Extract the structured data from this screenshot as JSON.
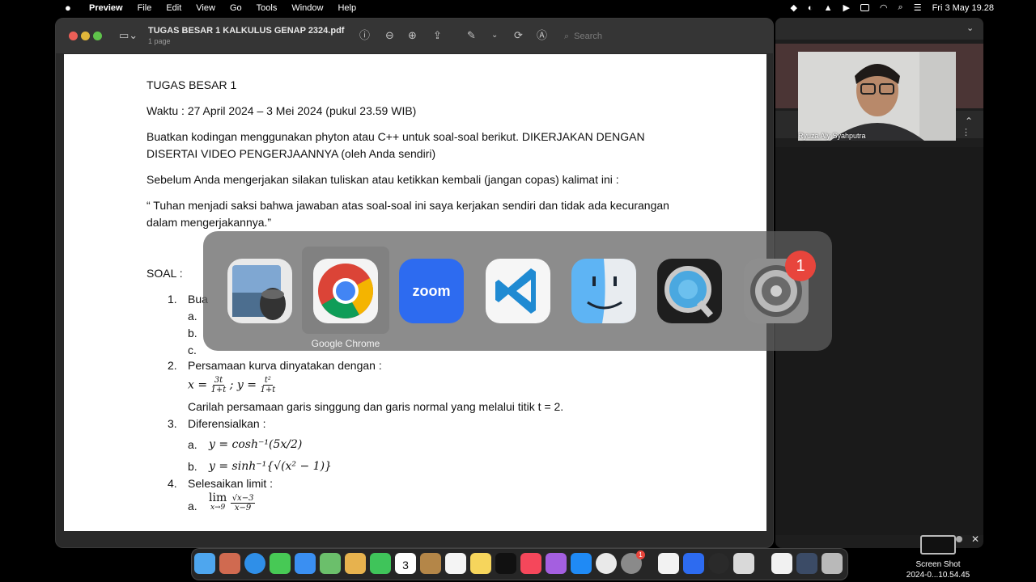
{
  "menubar": {
    "app": "Preview",
    "items": [
      "File",
      "Edit",
      "View",
      "Go",
      "Tools",
      "Window",
      "Help"
    ],
    "clock": "Fri 3 May  19.28"
  },
  "window": {
    "title": "TUGAS BESAR 1 KALKULUS GENAP 2324.pdf",
    "subtitle": "1 page",
    "search_placeholder": "Search"
  },
  "document": {
    "heading": "TUGAS BESAR 1",
    "time": "Waktu : 27 April 2024 – 3 Mei 2024 (pukul 23.59 WIB)",
    "instr1": "Buatkan kodingan menggunakan phyton atau C++ untuk soal-soal berikut. DIKERJAKAN DENGAN",
    "instr2": "DISERTAI VIDEO PENGERJAANNYA (oleh Anda sendiri)",
    "before": "Sebelum Anda mengerjakan silakan tuliskan atau ketikkan kembali (jangan copas) kalimat ini :",
    "quote1": "“ Tuhan menjadi saksi bahwa jawaban atas soal-soal ini saya kerjakan sendiri dan tidak ada kecurangan",
    "quote2": "dalam mengerjakannya.”",
    "soal": "SOAL :",
    "q1_num": "1.",
    "q1_text": "Bua",
    "q1_a": "a.",
    "q1_b": "b.",
    "q1_c": "c.",
    "q2_num": "2.",
    "q2_text": "Persamaan kurva dinyatakan dengan :",
    "q2_x": "x =",
    "q2_x_num": "3t",
    "q2_x_den": "1+t",
    "q2_y": "; y =",
    "q2_y_num": "t²",
    "q2_y_den": "1+t",
    "q2_task": "Carilah persamaan garis singgung dan garis normal yang melalui titik t = 2.",
    "q3_num": "3.",
    "q3_text": "Diferensialkan :",
    "q3_a": "a.",
    "q3_a_expr": "y = cosh⁻¹(5x/2)",
    "q3_b": "b.",
    "q3_b_expr": "y = sinh⁻¹{√(x² − 1)}",
    "q4_num": "4.",
    "q4_text": "Selesaikan limit :",
    "q4_a": "a.",
    "q4_lim": "lim",
    "q4_sub": "x→9",
    "q4_num_expr": "√x−3",
    "q4_den_expr": "x−9"
  },
  "zoom": {
    "participant": "Ryuza Aly Syahputra"
  },
  "app_switcher": {
    "apps": [
      "Preview",
      "Google Chrome",
      "zoom",
      "Visual Studio Code",
      "Finder",
      "QuickTime Player",
      "System Settings"
    ],
    "selected_label": "Google Chrome",
    "settings_badge": "1"
  },
  "dock": {
    "calendar_month": "MAY",
    "calendar_day": "3",
    "settings_badge": "1"
  },
  "desktop": {
    "screenshot_label1": "Screen Shot",
    "screenshot_label2": "2024-0...10.54.45"
  }
}
